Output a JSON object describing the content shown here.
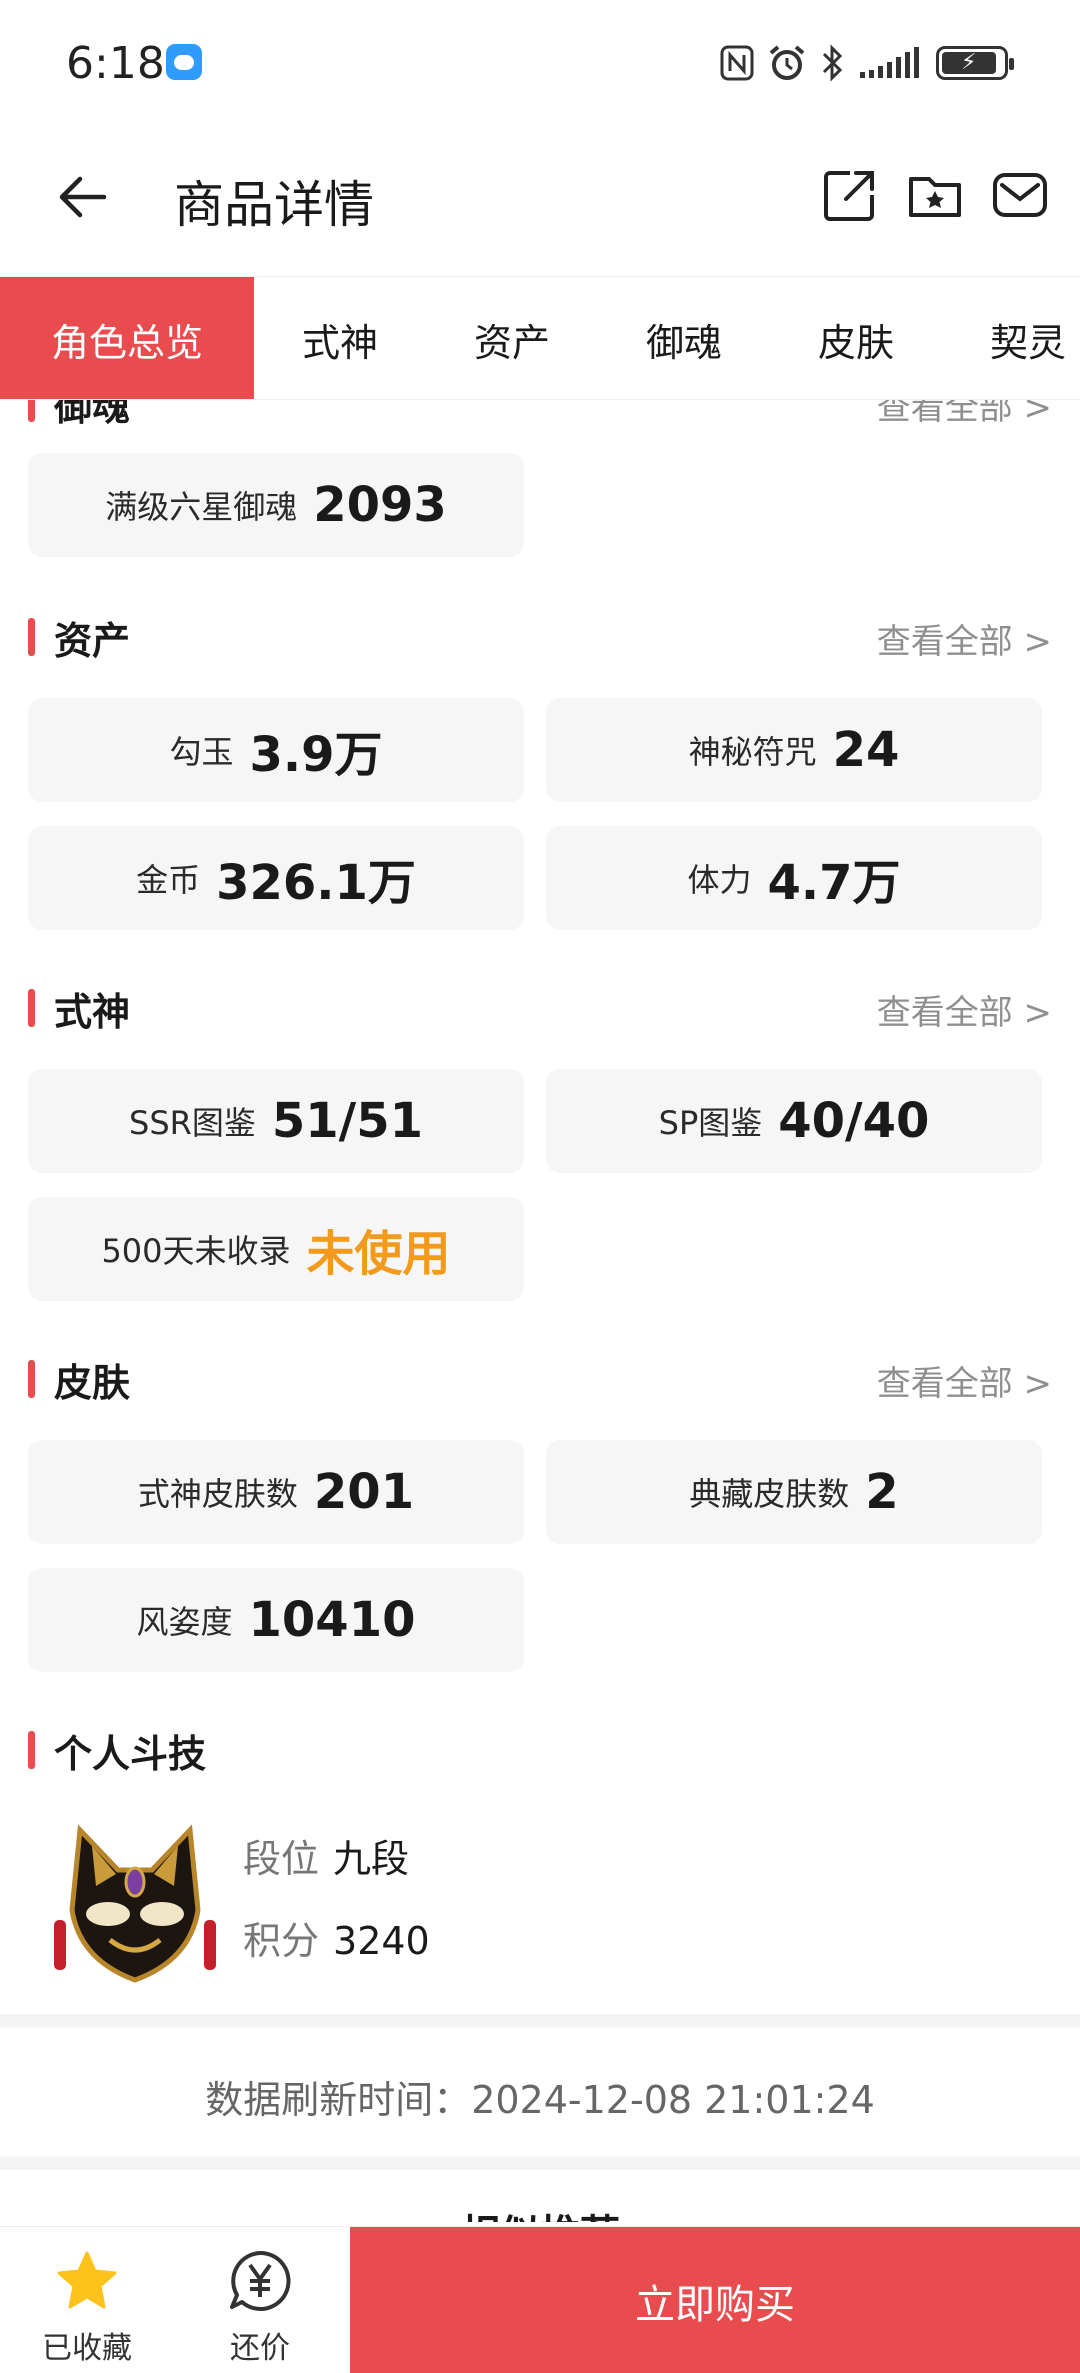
{
  "status": {
    "time": "6:18",
    "icons": [
      "nfc-icon",
      "alarm-icon",
      "bluetooth-icon",
      "signal-icon",
      "battery-icon"
    ]
  },
  "header": {
    "title": "商品详情",
    "icons": [
      "back-arrow-icon",
      "share-icon",
      "folder-star-icon",
      "mail-icon"
    ]
  },
  "tabs": [
    "角色总览",
    "式神",
    "资产",
    "御魂",
    "皮肤",
    "契灵"
  ],
  "sections": {
    "yuhun": {
      "title": "御魂",
      "more": "查看全部 >",
      "cards": [
        {
          "label": "满级六星御魂",
          "value": "2093"
        }
      ]
    },
    "assets": {
      "title": "资产",
      "more": "查看全部 >",
      "cards": [
        {
          "label": "勾玉",
          "value": "3.9万"
        },
        {
          "label": "神秘符咒",
          "value": "24"
        },
        {
          "label": "金币",
          "value": "326.1万"
        },
        {
          "label": "体力",
          "value": "4.7万"
        }
      ]
    },
    "shikigami": {
      "title": "式神",
      "more": "查看全部 >",
      "cards": [
        {
          "label": "SSR图鉴",
          "value": "51/51"
        },
        {
          "label": "SP图鉴",
          "value": "40/40"
        },
        {
          "label": "500天未收录",
          "value": "未使用"
        }
      ]
    },
    "skins": {
      "title": "皮肤",
      "more": "查看全部 >",
      "cards": [
        {
          "label": "式神皮肤数",
          "value": "201"
        },
        {
          "label": "典藏皮肤数",
          "value": "2"
        },
        {
          "label": "风姿度",
          "value": "10410"
        }
      ]
    },
    "pvp": {
      "title": "个人斗技",
      "rank_label": "段位",
      "rank_value": "九段",
      "score_label": "积分",
      "score_value": "3240"
    }
  },
  "refresh_text": "数据刷新时间：2024-12-08 21:01:24",
  "similar_title": "相似推荐",
  "bottom": {
    "favorite_label": "已收藏",
    "bargain_label": "还价",
    "buy_label": "立即购买"
  },
  "colors": {
    "accent": "#e84c4f",
    "highlight": "#f39a1d",
    "favorite_star": "#ffc21a"
  }
}
